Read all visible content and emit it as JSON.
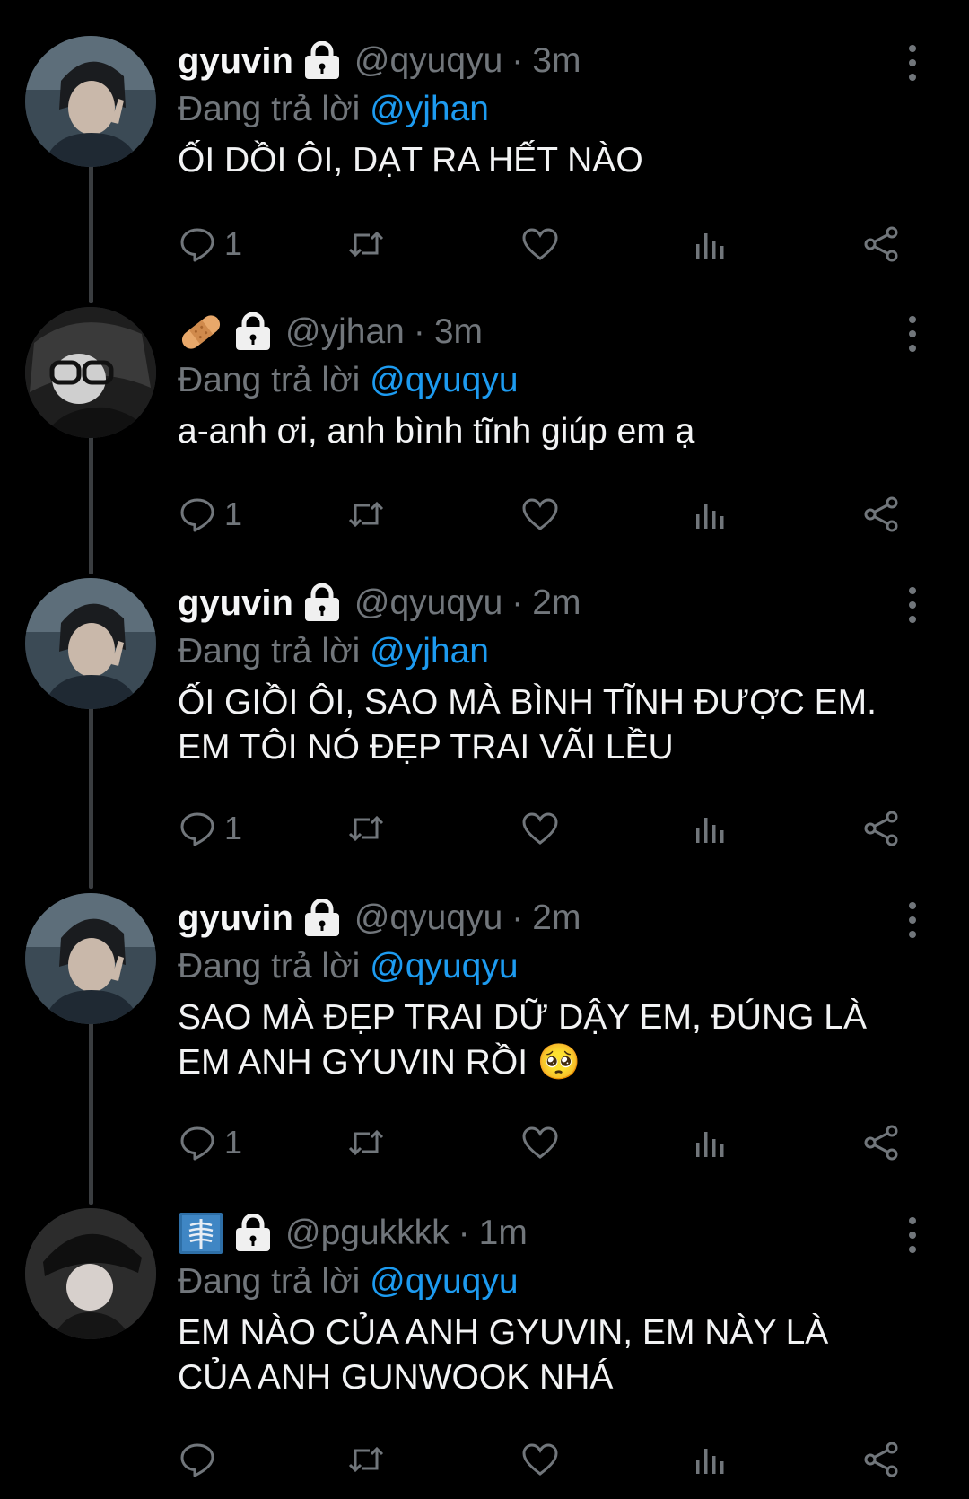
{
  "tweets": [
    {
      "display_name": "gyuvin",
      "name_emoji": "",
      "handle": "@qyuqyu",
      "separator": "·",
      "time": "3m",
      "reply_prefix": "Đang trả lời",
      "reply_to": "@yjhan",
      "text": "ỐI DỒI ÔI, DẠT RA HẾT NÀO",
      "reply_count": "1"
    },
    {
      "display_name": "",
      "name_emoji": "bandage-emoji",
      "handle": "@yjhan",
      "separator": "·",
      "time": "3m",
      "reply_prefix": "Đang trả lời",
      "reply_to": "@qyuqyu",
      "text": "a-anh ơi, anh bình tĩnh giúp em ạ",
      "reply_count": "1"
    },
    {
      "display_name": "gyuvin",
      "name_emoji": "",
      "handle": "@qyuqyu",
      "separator": "·",
      "time": "2m",
      "reply_prefix": "Đang trả lời",
      "reply_to": "@yjhan",
      "text": "ỐI GIỒI ÔI, SAO MÀ BÌNH TĨNH ĐƯỢC EM.\nEM TÔI NÓ ĐẸP TRAI VÃI LỀU",
      "reply_count": "1"
    },
    {
      "display_name": "gyuvin",
      "name_emoji": "",
      "handle": "@qyuqyu",
      "separator": "·",
      "time": "2m",
      "reply_prefix": "Đang trả lời",
      "reply_to": "@qyuqyu",
      "text": "SAO MÀ ĐẸP TRAI DỮ DẬY EM, ĐÚNG LÀ\nEM ANH GYUVIN RỒI 🥺",
      "reply_count": "1"
    },
    {
      "display_name": "",
      "name_emoji": "x-ray-emoji",
      "handle": "@pgukkkk",
      "separator": "·",
      "time": "1m",
      "reply_prefix": "Đang trả lời",
      "reply_to": "@qyuqyu",
      "text": "EM NÀO CỦA ANH GYUVIN, EM NÀY LÀ\nCỦA ANH GUNWOOK NHÁ",
      "reply_count": ""
    }
  ],
  "icons": {
    "reply": "reply-icon",
    "retweet": "retweet-icon",
    "like": "like-icon",
    "views": "views-icon",
    "share": "share-icon",
    "lock": "lock-icon",
    "more": "more-options-icon"
  },
  "colors": {
    "background": "#000000",
    "text": "#e7e9ea",
    "muted": "#71767b",
    "link": "#1d9bf0"
  }
}
